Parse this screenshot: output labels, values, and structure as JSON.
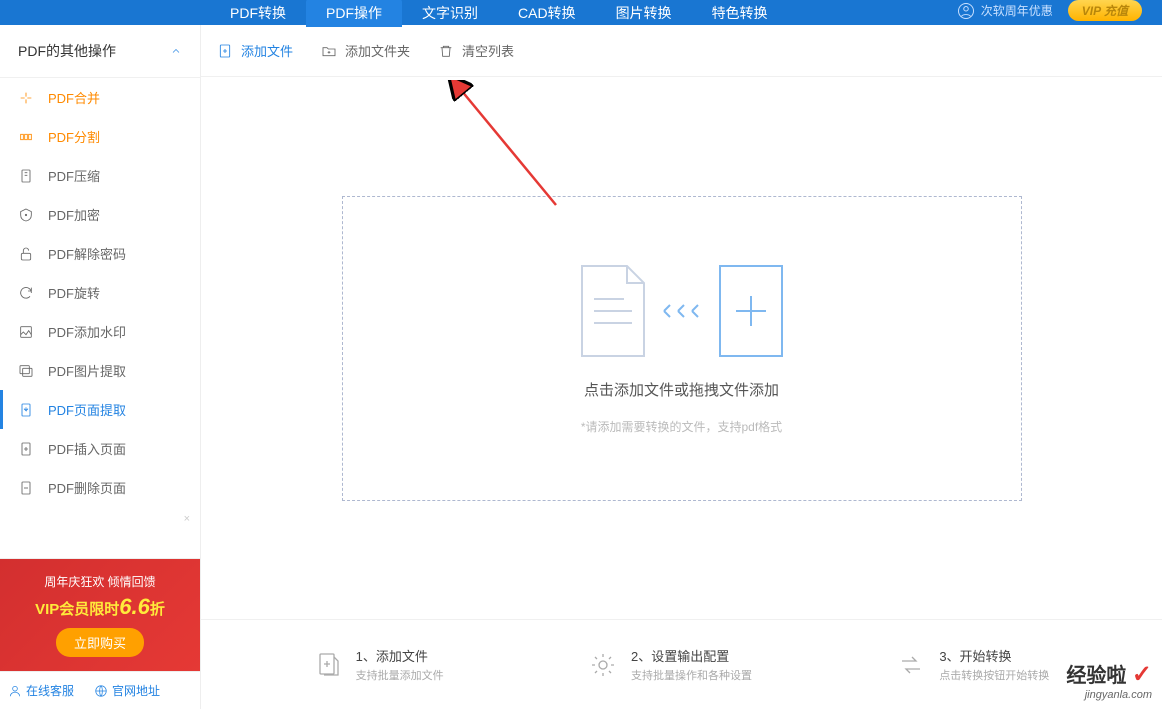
{
  "nav": {
    "tabs": [
      "PDF转换",
      "PDF操作",
      "文字识别",
      "CAD转换",
      "图片转换",
      "特色转换"
    ],
    "active_index": 1,
    "user_text": "次软周年优惠",
    "vip_label": "VIP 充值"
  },
  "sidebar": {
    "title": "PDF的其他操作",
    "items": [
      {
        "label": "PDF合并",
        "icon": "merge-icon",
        "orange": true
      },
      {
        "label": "PDF分割",
        "icon": "split-icon",
        "orange": true
      },
      {
        "label": "PDF压缩",
        "icon": "compress-icon"
      },
      {
        "label": "PDF加密",
        "icon": "lock-icon"
      },
      {
        "label": "PDF解除密码",
        "icon": "unlock-icon"
      },
      {
        "label": "PDF旋转",
        "icon": "rotate-icon"
      },
      {
        "label": "PDF添加水印",
        "icon": "watermark-icon"
      },
      {
        "label": "PDF图片提取",
        "icon": "image-extract-icon"
      },
      {
        "label": "PDF页面提取",
        "icon": "page-extract-icon",
        "active": true
      },
      {
        "label": "PDF插入页面",
        "icon": "insert-page-icon"
      },
      {
        "label": "PDF删除页面",
        "icon": "delete-page-icon"
      }
    ]
  },
  "promo": {
    "line1": "周年庆狂欢 倾情回馈",
    "line2_prefix": "VIP会员限时",
    "line2_big": "6.6",
    "line2_suffix": "折",
    "button": "立即购买"
  },
  "bottom_links": {
    "service": "在线客服",
    "website": "官网地址"
  },
  "toolbar": {
    "add_file": "添加文件",
    "add_folder": "添加文件夹",
    "clear_list": "清空列表"
  },
  "dropzone": {
    "main_text": "点击添加文件或拖拽文件添加",
    "sub_text": "*请添加需要转换的文件，支持pdf格式"
  },
  "steps": [
    {
      "title": "1、添加文件",
      "sub": "支持批量添加文件"
    },
    {
      "title": "2、设置输出配置",
      "sub": "支持批量操作和各种设置"
    },
    {
      "title": "3、开始转换",
      "sub": "点击转换按钮开始转换"
    }
  ],
  "watermark": {
    "brand": "经验啦",
    "url": "jingyanla.com"
  }
}
